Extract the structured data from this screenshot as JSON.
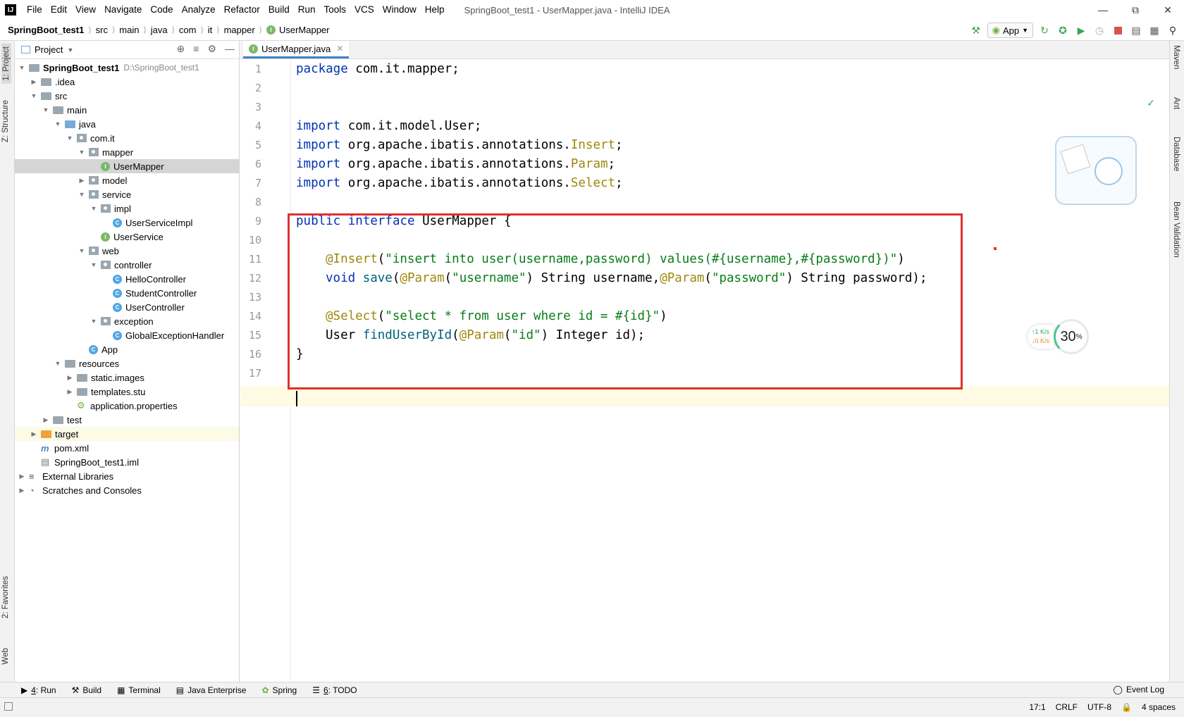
{
  "window": {
    "title": "SpringBoot_test1 - UserMapper.java - IntelliJ IDEA",
    "logo": "IJ",
    "controls": [
      "minimize-icon",
      "restore-icon",
      "close-icon"
    ]
  },
  "menu": [
    "File",
    "Edit",
    "View",
    "Navigate",
    "Code",
    "Analyze",
    "Refactor",
    "Build",
    "Run",
    "Tools",
    "VCS",
    "Window",
    "Help"
  ],
  "breadcrumbs": [
    "SpringBoot_test1",
    "src",
    "main",
    "java",
    "com",
    "it",
    "mapper",
    "UserMapper"
  ],
  "toolbar": {
    "run_config": "App",
    "icons": [
      "build-hammer-icon",
      "rerun-icon",
      "debug-icon",
      "coverage-icon",
      "profile-icon",
      "stop-icon",
      "project-structure-icon",
      "terminal-window-icon",
      "search-icon"
    ]
  },
  "left_tabs": [
    "1: Project",
    "Z: Structure",
    "2: Favorites",
    "Web"
  ],
  "right_tabs": [
    "Maven",
    "Ant",
    "Database",
    "Bean Validation"
  ],
  "project_panel": {
    "title": "Project",
    "tree": [
      {
        "label": "SpringBoot_test1",
        "extra": "D:\\SpringBoot_test1",
        "level": 0,
        "expanded": true,
        "icon": "module-folder"
      },
      {
        "label": ".idea",
        "level": 1,
        "expanded": false,
        "icon": "folder"
      },
      {
        "label": "src",
        "level": 1,
        "expanded": true,
        "icon": "folder"
      },
      {
        "label": "main",
        "level": 2,
        "expanded": true,
        "icon": "folder"
      },
      {
        "label": "java",
        "level": 3,
        "expanded": true,
        "icon": "source-folder"
      },
      {
        "label": "com.it",
        "level": 4,
        "expanded": true,
        "icon": "package"
      },
      {
        "label": "mapper",
        "level": 5,
        "expanded": true,
        "icon": "package"
      },
      {
        "label": "UserMapper",
        "level": 6,
        "icon": "interface",
        "selected": true
      },
      {
        "label": "model",
        "level": 5,
        "expanded": false,
        "icon": "package"
      },
      {
        "label": "service",
        "level": 5,
        "expanded": true,
        "icon": "package"
      },
      {
        "label": "impl",
        "level": 6,
        "expanded": true,
        "icon": "package"
      },
      {
        "label": "UserServiceImpl",
        "level": 7,
        "icon": "class"
      },
      {
        "label": "UserService",
        "level": 6,
        "icon": "interface"
      },
      {
        "label": "web",
        "level": 5,
        "expanded": true,
        "icon": "package"
      },
      {
        "label": "controller",
        "level": 6,
        "expanded": true,
        "icon": "package"
      },
      {
        "label": "HelloController",
        "level": 7,
        "icon": "class"
      },
      {
        "label": "StudentController",
        "level": 7,
        "icon": "class"
      },
      {
        "label": "UserController",
        "level": 7,
        "icon": "class"
      },
      {
        "label": "exception",
        "level": 6,
        "expanded": true,
        "icon": "package"
      },
      {
        "label": "GlobalExceptionHandler",
        "level": 7,
        "icon": "class"
      },
      {
        "label": "App",
        "level": 5,
        "icon": "spring-boot-class"
      },
      {
        "label": "resources",
        "level": 3,
        "expanded": true,
        "icon": "resources-folder"
      },
      {
        "label": "static.images",
        "level": 4,
        "expanded": false,
        "icon": "folder"
      },
      {
        "label": "templates.stu",
        "level": 4,
        "expanded": false,
        "icon": "folder"
      },
      {
        "label": "application.properties",
        "level": 4,
        "icon": "properties-file"
      },
      {
        "label": "test",
        "level": 2,
        "expanded": false,
        "icon": "folder"
      },
      {
        "label": "target",
        "level": 1,
        "expanded": false,
        "icon": "excluded-folder"
      },
      {
        "label": "pom.xml",
        "level": 1,
        "icon": "maven-file"
      },
      {
        "label": "SpringBoot_test1.iml",
        "level": 1,
        "icon": "iml-file"
      },
      {
        "label": "External Libraries",
        "level": 0,
        "expanded": false,
        "icon": "libraries"
      },
      {
        "label": "Scratches and Consoles",
        "level": 0,
        "expanded": false,
        "icon": "scratches"
      }
    ]
  },
  "editor": {
    "tab": "UserMapper.java",
    "line_numbers": [
      "1",
      "2",
      "3",
      "4",
      "5",
      "6",
      "7",
      "8",
      "9",
      "10",
      "11",
      "12",
      "13",
      "14",
      "15",
      "16",
      "17"
    ],
    "code": {
      "l1_kw": "package",
      "l1_rest": " com.it.mapper;",
      "l4_kw": "import",
      "l4_rest": " com.it.model.User;",
      "l5_kw": "import",
      "l5_rest": " org.apache.ibatis.annotations.",
      "l5_ann": "Insert",
      "l5_end": ";",
      "l6_kw": "import",
      "l6_rest": " org.apache.ibatis.annotations.",
      "l6_ann": "Param",
      "l6_end": ";",
      "l7_kw": "import",
      "l7_rest": " org.apache.ibatis.annotations.",
      "l7_ann": "Select",
      "l7_end": ";",
      "l9_kw": "public interface",
      "l9_rest": " UserMapper {",
      "l11_ann": "@Insert",
      "l11_p1": "(",
      "l11_str": "\"insert into user(username,password) values(#{username},#{password})\"",
      "l11_p2": ")",
      "l12_kw": "void",
      "l12_fn": "save",
      "l12_p1": "(",
      "l12_ann1": "@Param",
      "l12_p2": "(",
      "l12_str1": "\"username\"",
      "l12_p3": ") String username,",
      "l12_ann2": "@Param",
      "l12_p4": "(",
      "l12_str2": "\"password\"",
      "l12_p5": ") String password);",
      "l14_ann": "@Select",
      "l14_p1": "(",
      "l14_str": "\"select * from user where id = #{id}\"",
      "l14_p2": ")",
      "l15_type": "User ",
      "l15_fn": "findUserById",
      "l15_p1": "(",
      "l15_ann": "@Param",
      "l15_p2": "(",
      "l15_str": "\"id\"",
      "l15_p3": ") Integer id);",
      "l16": "}"
    }
  },
  "net_widget": {
    "up": "↑1  K/s",
    "down": "↓0  K/s",
    "value": "30",
    "unit": "%"
  },
  "bottom_tools": [
    {
      "num": "4",
      "label": ": Run",
      "icon": "run-icon"
    },
    {
      "num": "",
      "label": "Build",
      "icon": "build-icon"
    },
    {
      "num": "",
      "label": "Terminal",
      "icon": "terminal-icon"
    },
    {
      "num": "",
      "label": "Java Enterprise",
      "icon": "java-enterprise-icon"
    },
    {
      "num": "",
      "label": "Spring",
      "icon": "spring-icon"
    },
    {
      "num": "6",
      "label": ": TODO",
      "icon": "todo-icon"
    }
  ],
  "event_log": "Event Log",
  "status": {
    "position": "17:1",
    "line_sep": "CRLF",
    "encoding": "UTF-8",
    "indent": "4 spaces"
  },
  "colors": {
    "keyword": "#0033b3",
    "annotation": "#9e880d",
    "string": "#067d17",
    "highlight_box": "#e03030"
  }
}
